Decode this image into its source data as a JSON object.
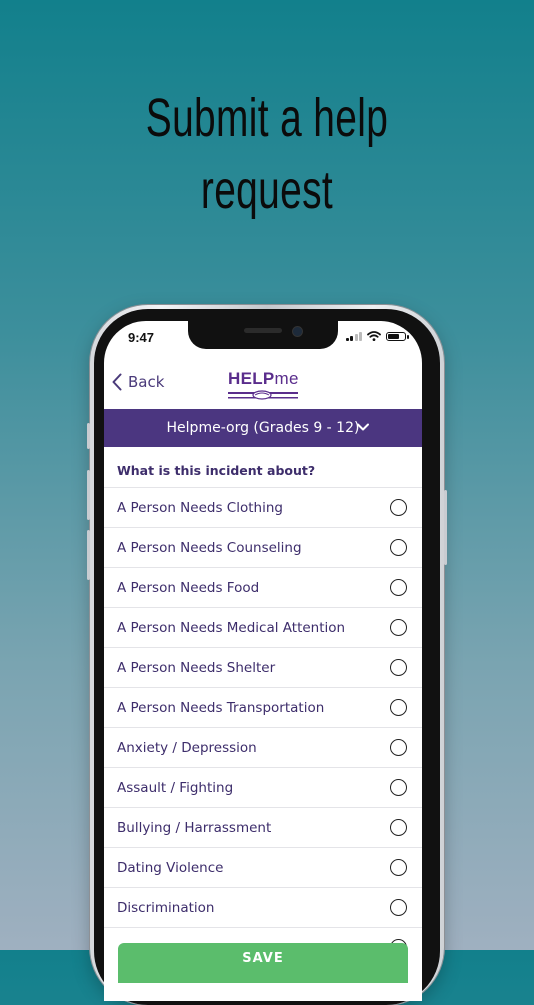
{
  "headline": {
    "line1": "Submit a help",
    "line2": "request"
  },
  "status_bar": {
    "time": "9:47"
  },
  "nav": {
    "back_label": "Back",
    "logo_main": "HELP",
    "logo_sub": "me"
  },
  "org_selector": {
    "label": "Helpme-org (Grades 9 - 12)"
  },
  "question": "What is this incident about?",
  "options": [
    "A Person Needs Clothing",
    "A Person Needs Counseling",
    "A Person Needs Food",
    "A Person Needs Medical Attention",
    "A Person Needs Shelter",
    "A Person Needs Transportation",
    "Anxiety / Depression",
    "Assault / Fighting",
    "Bullying / Harrassment",
    "Dating Violence",
    "Discrimination"
  ],
  "save_label": "SAVE",
  "colors": {
    "accent": "#4b3680",
    "text": "#3d2d6b",
    "save": "#5bbd6c"
  },
  "icons": [
    "chevron-left-icon",
    "chevron-down-icon",
    "radio-icon",
    "signal-icon",
    "wifi-icon",
    "battery-icon"
  ]
}
